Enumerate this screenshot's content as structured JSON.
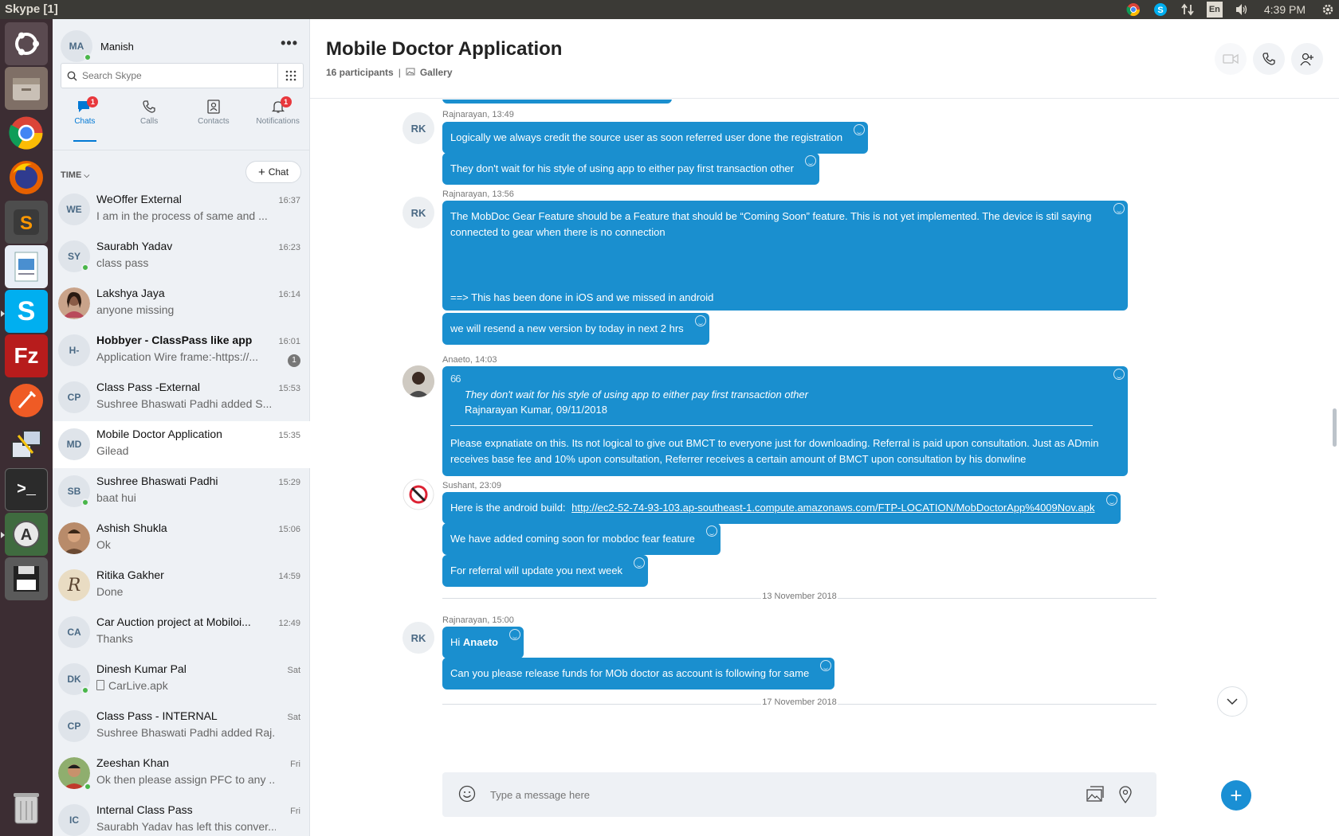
{
  "window": {
    "title": "Skype [1]"
  },
  "system_tray": {
    "language": "En",
    "clock": "4:39 PM"
  },
  "launcher": {
    "apps": [
      "dash-icon",
      "files-icon",
      "chrome-icon",
      "firefox-icon",
      "sublime-text-icon",
      "document-viewer-icon",
      "skype-icon",
      "filezilla-icon",
      "postman-icon",
      "network-tool-icon",
      "terminal-icon",
      "software-updater-icon",
      "save-icon",
      "trash-icon"
    ]
  },
  "profile": {
    "initials": "MA",
    "name": "Manish"
  },
  "search": {
    "placeholder": "Search Skype"
  },
  "nav": {
    "chats": "Chats",
    "calls": "Calls",
    "contacts": "Contacts",
    "notifications": "Notifications",
    "chats_badge": "1",
    "notifications_badge": "1"
  },
  "list_header": {
    "sort_label": "TIME",
    "new_chat": "Chat"
  },
  "chats": [
    {
      "initials": "WE",
      "name": "WeOffer External",
      "preview": "I am in the process of same and ...",
      "time": "16:37"
    },
    {
      "initials": "SY",
      "name": "Saurabh Yadav",
      "preview": "class pass",
      "time": "16:23"
    },
    {
      "name": "Lakshya Jaya",
      "preview": "anyone missing",
      "time": "16:14"
    },
    {
      "initials": "H-",
      "name": "Hobbyer - ClassPass like app",
      "preview": "Application Wire  frame:-https://...",
      "time": "16:01",
      "unread": "1"
    },
    {
      "initials": "CP",
      "name": "Class Pass  -External",
      "preview": "Sushree Bhaswati Padhi added S...",
      "time": "15:53"
    },
    {
      "initials": "MD",
      "name": "Mobile Doctor Application",
      "preview": "Gilead",
      "time": "15:35"
    },
    {
      "initials": "SB",
      "name": "Sushree Bhaswati Padhi",
      "preview": "baat hui",
      "time": "15:29"
    },
    {
      "name": "Ashish Shukla",
      "preview": "Ok",
      "time": "15:06"
    },
    {
      "initials": "R",
      "name": "Ritika Gakher",
      "preview": "Done",
      "time": "14:59"
    },
    {
      "initials": "CA",
      "name": "Car Auction project at Mobiloi...",
      "preview": "Thanks",
      "time": "12:49"
    },
    {
      "initials": "DK",
      "name": "Dinesh Kumar Pal",
      "preview": "CarLive.apk",
      "time": "Sat"
    },
    {
      "initials": "CP",
      "name": "Class Pass - INTERNAL",
      "preview": "Sushree Bhaswati Padhi added Raj...",
      "time": "Sat"
    },
    {
      "name": "Zeeshan Khan",
      "preview": "Ok then please assign PFC to any ...",
      "time": "Fri"
    },
    {
      "initials": "IC",
      "name": "Internal Class Pass",
      "preview": "Saurabh Yadav has left this conver...",
      "time": "Fri"
    }
  ],
  "conversation": {
    "title": "Mobile Doctor Application",
    "participants": "16 participants",
    "separator": "|",
    "gallery": "Gallery"
  },
  "messages": {
    "g1": {
      "initials": "RK",
      "meta": "Rajnarayan, 13:49",
      "m1": "Logically we always credit the source user as soon referred user done the registration",
      "m2": "They don't wait for his style of using app to either pay first transaction other"
    },
    "g2": {
      "initials": "RK",
      "meta": "Rajnarayan, 13:56",
      "m1a": "The MobDoc Gear Feature should be a Feature that should be “Coming Soon” feature. This is not yet implemented. The device is stil saying connected to gear when there is no connection",
      "m1b": "==> This has been done in iOS and we missed in android",
      "m2": "we will resend a new version by today in next 2 hrs"
    },
    "g3": {
      "meta": "Anaeto, 14:03",
      "quote_mark": "66",
      "quote_text": "They don't wait for his style of using app to either pay first transaction other",
      "quote_author": "Rajnarayan Kumar, 09/11/2018",
      "body": "Please expnatiate on this. Its not logical to give out BMCT to everyone just for downloading. Referral is paid upon consultation. Just as ADmin receives base fee and 10% upon consultation, Referrer receives a certain amount of BMCT upon consultation by his donwline"
    },
    "g4": {
      "meta": "Sushant, 23:09",
      "m1_prefix": "Here is the android build:",
      "m1_link": "http://ec2-52-74-93-103.ap-southeast-1.compute.amazonaws.com/FTP-LOCATION/MobDoctorApp%4009Nov.apk",
      "m2": "We have added coming soon for  mobdoc fear feature",
      "m3": "For referral will update you next week"
    },
    "date1": "13 November 2018",
    "g5": {
      "initials": "RK",
      "meta": "Rajnarayan, 15:00",
      "m1_prefix": "Hi",
      "m1_mention": "Anaeto",
      "m2": "Can you please release funds for MOb doctor as account is following for same"
    },
    "date2": "17 November 2018"
  },
  "composer": {
    "placeholder": "Type a message here"
  },
  "colors": {
    "accent": "#0078d4",
    "bubble": "#1a8fcf",
    "online": "#49b649",
    "badge": "#e8383d"
  }
}
